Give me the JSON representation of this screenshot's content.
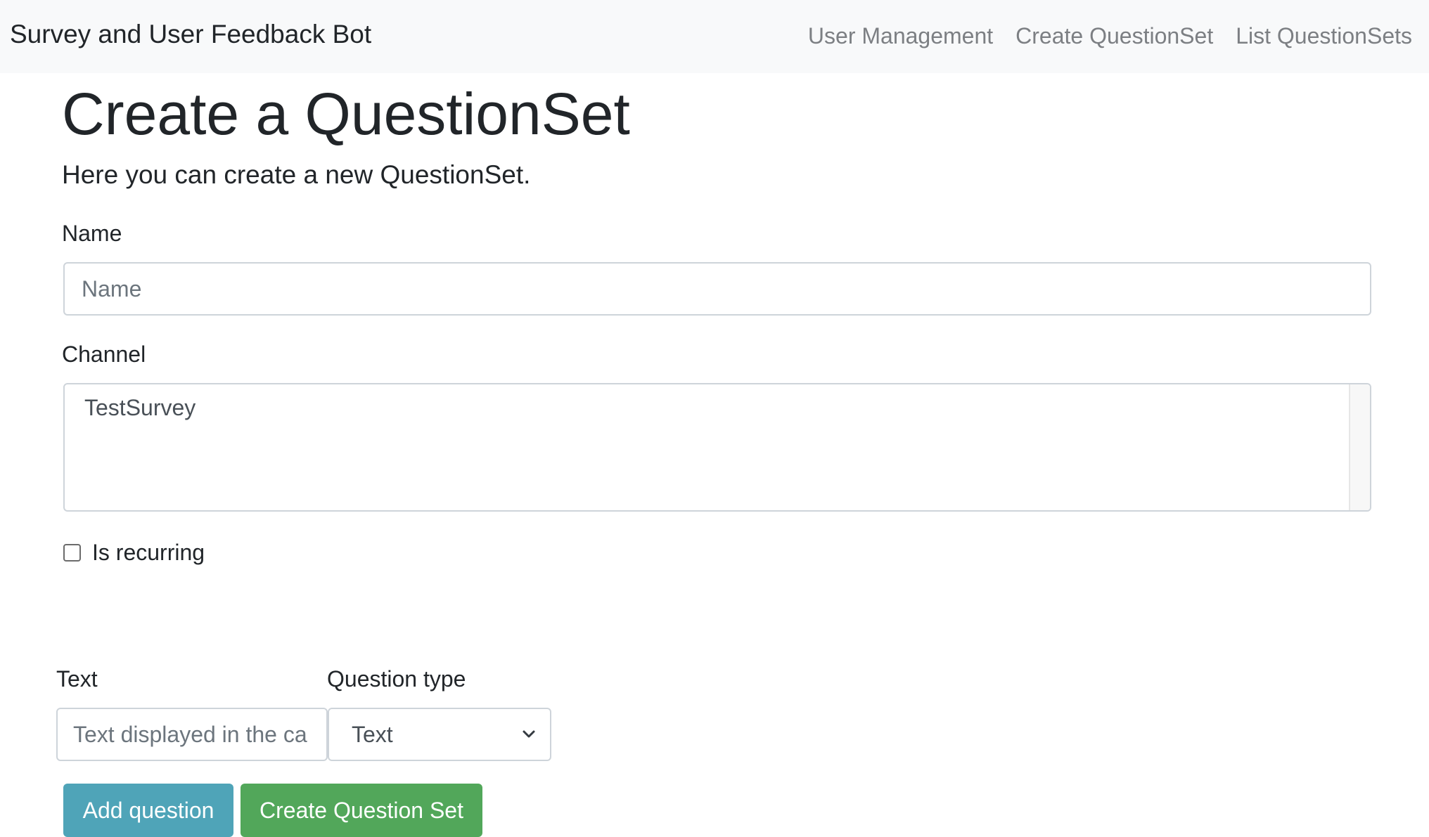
{
  "navbar": {
    "brand": "Survey and User Feedback Bot",
    "links": [
      {
        "label": "User Management"
      },
      {
        "label": "Create QuestionSet"
      },
      {
        "label": "List QuestionSets"
      }
    ]
  },
  "page": {
    "title": "Create a QuestionSet",
    "lead": "Here you can create a new QuestionSet."
  },
  "form": {
    "name_label": "Name",
    "name_placeholder": "Name",
    "name_value": "",
    "channel_label": "Channel",
    "channel_options": [
      "TestSurvey"
    ],
    "recurring_label": "Is recurring",
    "recurring_checked": false,
    "question": {
      "text_label": "Text",
      "text_placeholder": "Text displayed in the ca",
      "type_label": "Question type",
      "type_selected": "Text"
    },
    "add_question_label": "Add question",
    "create_label": "Create Question Set"
  },
  "colors": {
    "navbar_bg": "#f8f9fa",
    "info_button": "#4fa4b8",
    "success_button": "#52a75a"
  },
  "icons": [
    "chevron-down-icon"
  ]
}
